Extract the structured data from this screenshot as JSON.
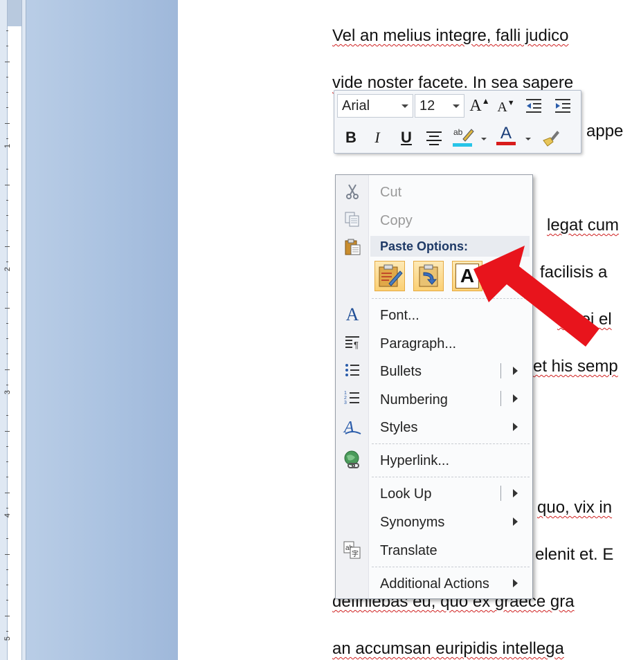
{
  "ruler": {
    "numbers": [
      "1",
      "2",
      "3",
      "4",
      "5"
    ]
  },
  "document": {
    "lines": [
      "Vel an melius integre, falli judico",
      "vide noster facete. In sea sapere",
      "appe",
      "legat cum",
      "facilisis a",
      "Sit ei el",
      "et his semp",
      "quo, vix in",
      "elenit et. E",
      "definiebas eu, quo ex graece gra",
      "an accumsan euripidis intellega"
    ]
  },
  "minibar": {
    "font_name": "Arial",
    "font_size": "12",
    "bold": "B",
    "italic": "I",
    "underline": "U",
    "grow_font": "A",
    "shrink_font": "A",
    "font_color_letter": "A",
    "highlight_color": "#27c4e8",
    "font_color": "#d81c1c"
  },
  "context_menu": {
    "cut": "Cut",
    "copy": "Copy",
    "paste_options": "Paste Options:",
    "paste_keep_text_letter": "A",
    "font": "Font...",
    "paragraph": "Paragraph...",
    "bullets": "Bullets",
    "numbering": "Numbering",
    "styles": "Styles",
    "hyperlink": "Hyperlink...",
    "look_up": "Look Up",
    "synonyms": "Synonyms",
    "translate": "Translate",
    "additional_actions": "Additional Actions",
    "icon_font_letter": "A"
  },
  "colors": {
    "accent_red": "#e8141c",
    "paste_header_text": "#1e3966",
    "ruler_side": "#a9c1e0"
  }
}
